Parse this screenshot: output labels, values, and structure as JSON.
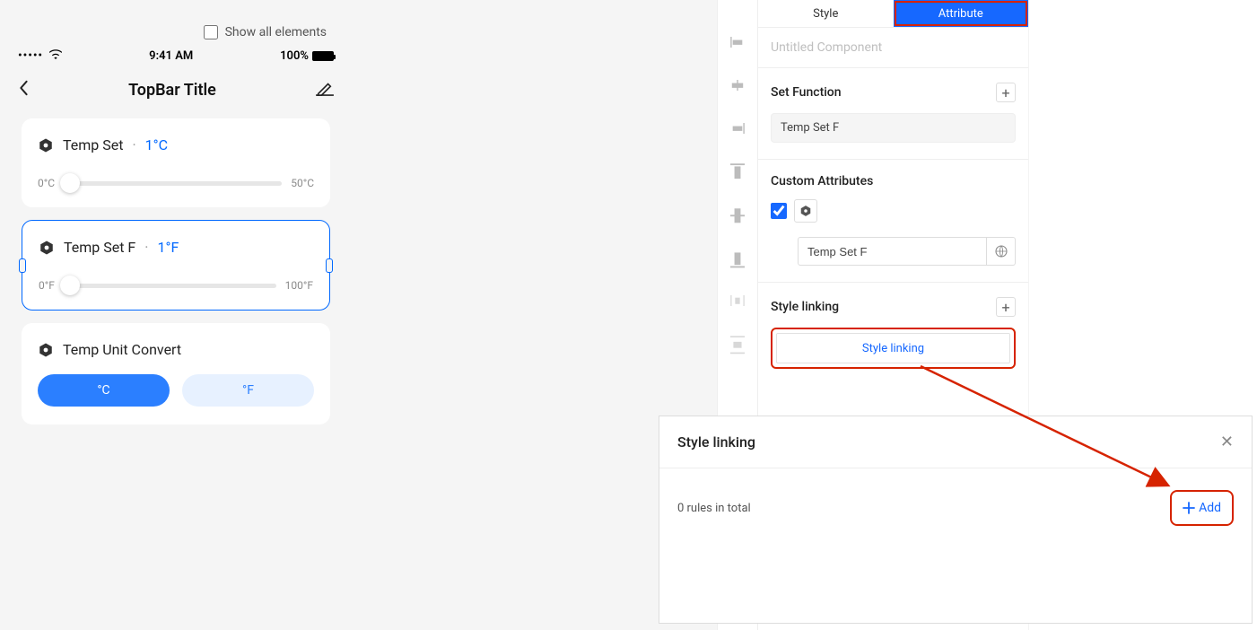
{
  "show_all_label": "Show all elements",
  "status": {
    "time": "9:41 AM",
    "battery": "100%"
  },
  "topbar": {
    "title": "TopBar Title"
  },
  "card1": {
    "title": "Temp Set",
    "value": "1°C",
    "min": "0°C",
    "max": "50°C"
  },
  "card2": {
    "title": "Temp Set F",
    "value": "1°F",
    "min": "0°F",
    "max": "100°F"
  },
  "card3": {
    "title": "Temp Unit Convert",
    "btn_c": "°C",
    "btn_f": "°F"
  },
  "tabs": {
    "style": "Style",
    "attribute": "Attribute"
  },
  "comp_name_placeholder": "Untitled Component",
  "set_function": {
    "label": "Set Function",
    "value": "Temp Set F"
  },
  "custom_attributes": {
    "label": "Custom Attributes",
    "value": "Temp Set F"
  },
  "style_linking": {
    "label": "Style linking",
    "button": "Style linking"
  },
  "popup": {
    "title": "Style linking",
    "count": "0 rules in total",
    "add": "Add"
  }
}
